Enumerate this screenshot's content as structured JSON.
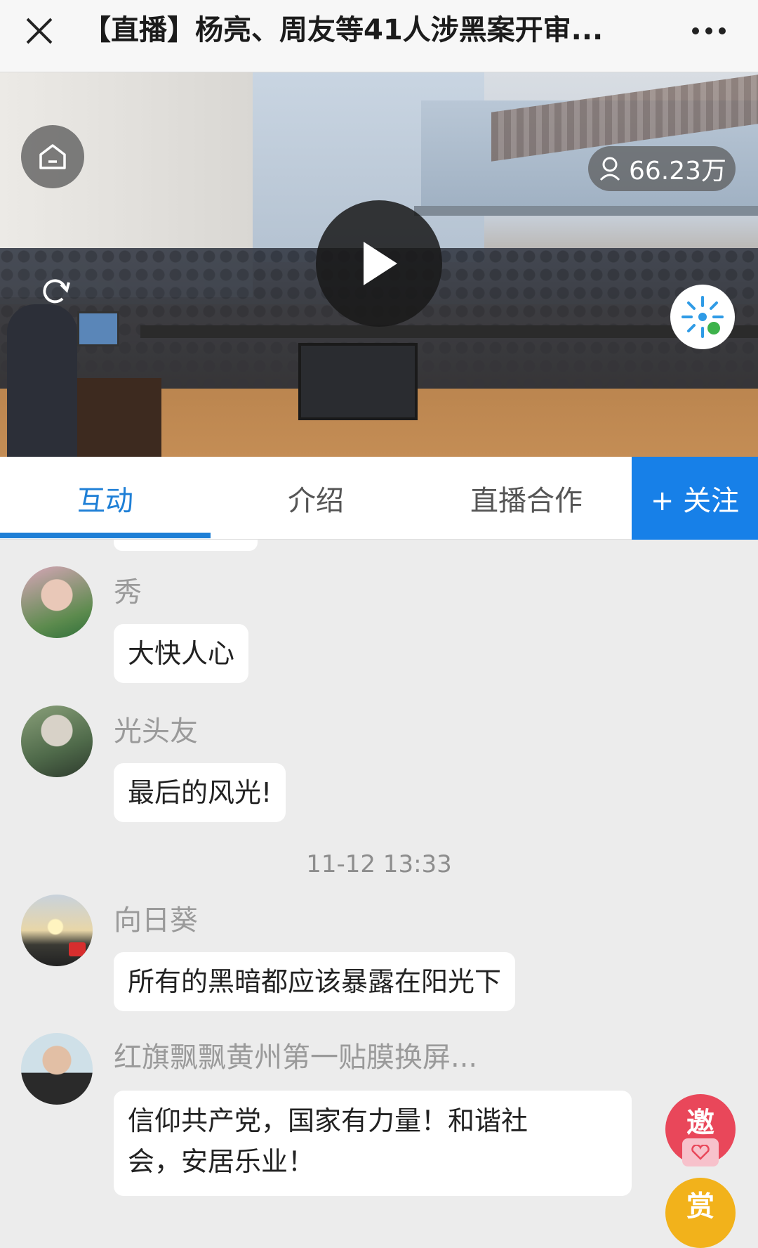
{
  "header": {
    "title": "【直播】杨亮、周友等41人涉黑案开审..."
  },
  "video": {
    "viewer_count": "66.23万"
  },
  "tabs": [
    {
      "label": "互动",
      "active": true
    },
    {
      "label": "介绍",
      "active": false
    },
    {
      "label": "直播合作",
      "active": false
    }
  ],
  "follow_label": "+ 关注",
  "messages": [
    {
      "user": "秀",
      "text": "大快人心"
    },
    {
      "user": "光头友",
      "text": "最后的风光!"
    },
    {
      "timestamp": "11-12 13:33"
    },
    {
      "user": "向日葵",
      "text": "所有的黑暗都应该暴露在阳光下"
    },
    {
      "user": "红旗飘飘黄州第一贴膜换屏...",
      "text_line1": "信仰共产党，国家有力量！和谐社",
      "text_line2": "会，安居乐业！"
    }
  ],
  "floating": {
    "invite_label": "邀",
    "reward_label": "赏"
  },
  "colors": {
    "accent": "#1e7fd6",
    "follow_bg": "#1780e8",
    "invite": "#e9475a",
    "reward": "#f2b21b"
  }
}
